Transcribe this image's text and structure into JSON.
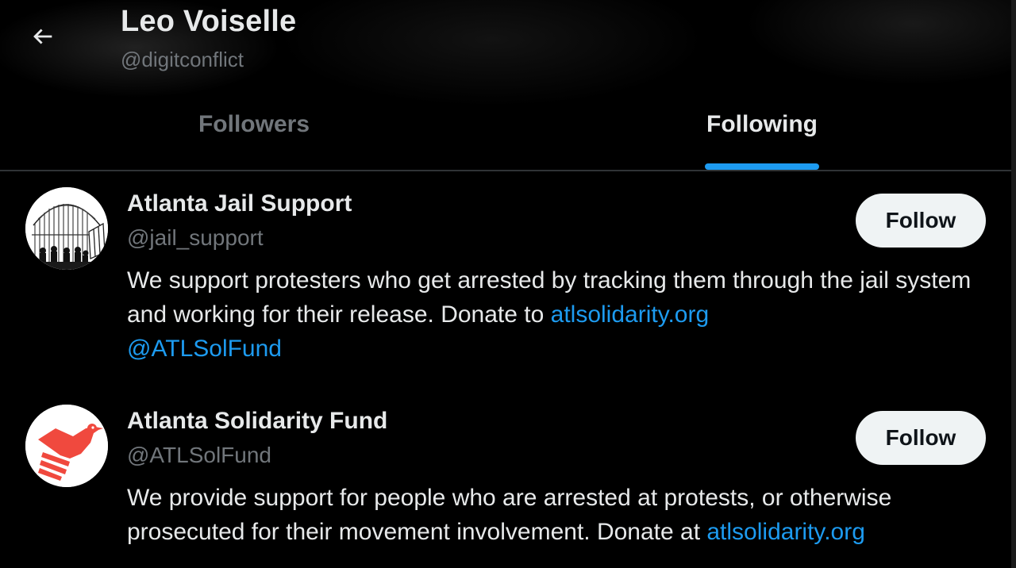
{
  "header": {
    "name": "Leo Voiselle",
    "handle": "@digitconflict",
    "back_icon": "arrow-left-icon"
  },
  "tabs": [
    {
      "label": "Followers",
      "active": false
    },
    {
      "label": "Following",
      "active": true
    }
  ],
  "colors": {
    "background": "#000000",
    "text_primary": "#e7e9ea",
    "text_secondary": "#71767b",
    "accent": "#1d9bf0",
    "follow_button_bg": "#eff3f4",
    "follow_button_text": "#0f1419",
    "fund_logo": "#f0493e"
  },
  "users": [
    {
      "name": "Atlanta Jail Support",
      "handle": "@jail_support",
      "avatar_icon": "birdcage-avatar",
      "follow_label": "Follow",
      "bio": {
        "text": "We support protesters who get arrested by tracking them through the jail system and working for their release. Donate to ",
        "link1": "atlsolidarity.org",
        "link2": "@ATLSolFund"
      }
    },
    {
      "name": "Atlanta Solidarity Fund",
      "handle": "@ATLSolFund",
      "avatar_icon": "bird-hand-logo-avatar",
      "follow_label": "Follow",
      "bio": {
        "text": "We provide support for people who are arrested at protests, or otherwise prosecuted for their movement involvement. Donate at ",
        "link1": "atlsolidarity.org"
      }
    }
  ]
}
